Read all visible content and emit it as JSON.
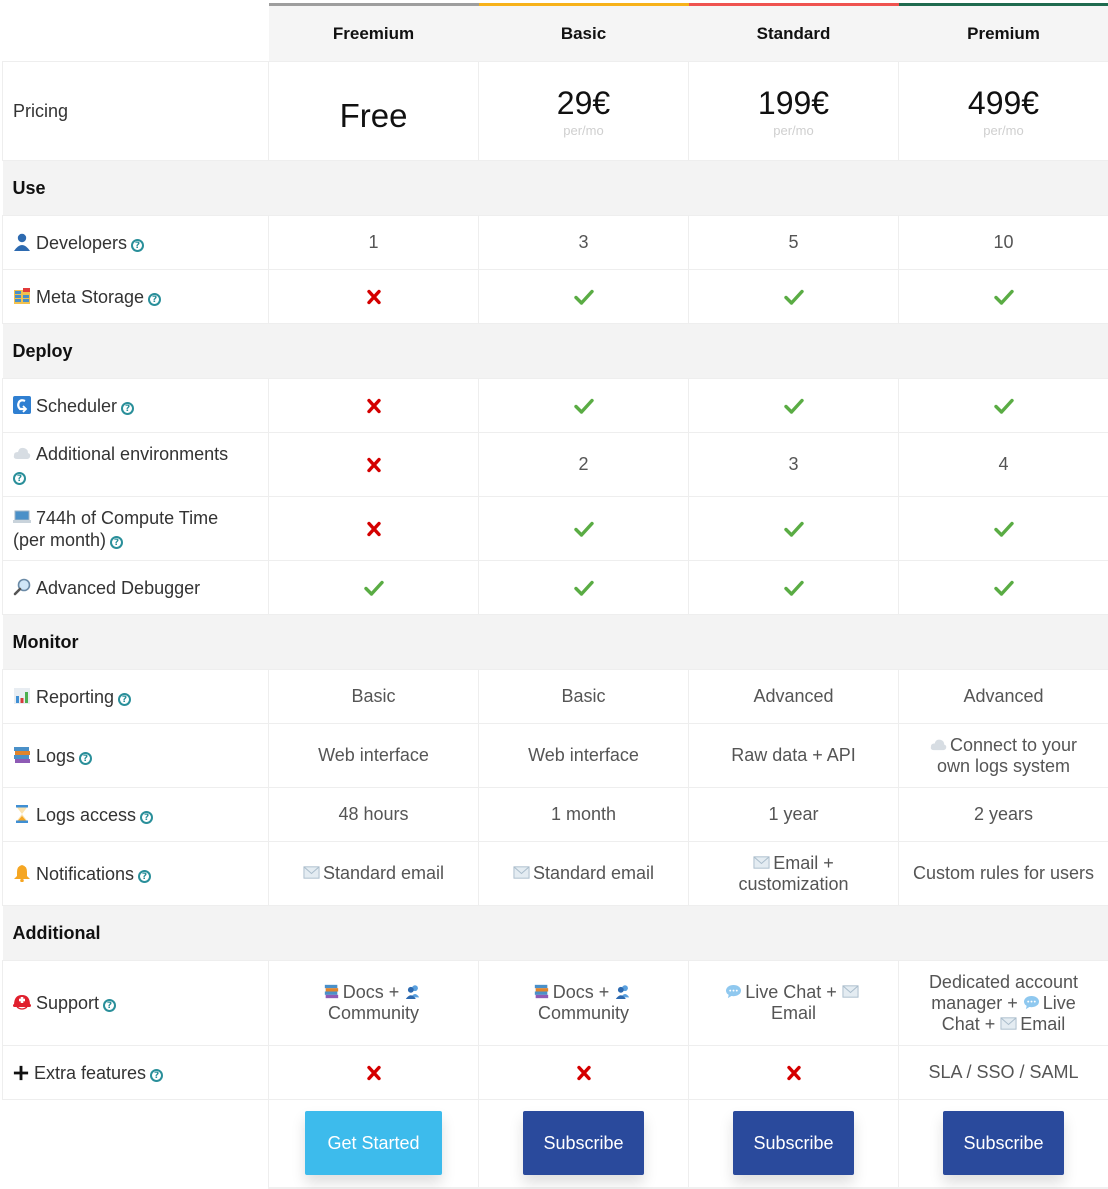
{
  "colors": {
    "freemium": "#9e9e9e",
    "basic": "#f7b21a",
    "standard": "#ef5350",
    "premium": "#1f6b4f",
    "check": "#5aac44",
    "cross": "#d40000",
    "help": "#2a8f9a",
    "get_started_bg": "#3dbbec",
    "subscribe_bg": "#2a4a9c"
  },
  "plans": [
    {
      "name": "Freemium",
      "price": "Free",
      "period": "",
      "cta": "Get Started"
    },
    {
      "name": "Basic",
      "price": "29€",
      "period": "per/mo",
      "cta": "Subscribe"
    },
    {
      "name": "Standard",
      "price": "199€",
      "period": "per/mo",
      "cta": "Subscribe"
    },
    {
      "name": "Premium",
      "price": "499€",
      "period": "per/mo",
      "cta": "Subscribe"
    }
  ],
  "pricing_label": "Pricing",
  "help_glyph": "?",
  "sections": {
    "use": {
      "title": "Use",
      "rows": [
        {
          "label": "Developers",
          "icon": "person-icon",
          "values": [
            "1",
            "3",
            "5",
            "10"
          ]
        },
        {
          "label": "Meta Storage",
          "icon": "storage-icon",
          "values": [
            "no",
            "yes",
            "yes",
            "yes"
          ]
        }
      ]
    },
    "deploy": {
      "title": "Deploy",
      "rows": [
        {
          "label": "Scheduler",
          "icon": "scheduler-icon",
          "values": [
            "no",
            "yes",
            "yes",
            "yes"
          ]
        },
        {
          "label": "Additional environments",
          "icon": "cloud-icon",
          "values": [
            "no",
            "2",
            "3",
            "4"
          ]
        },
        {
          "label": "744h of Compute Time (per month)",
          "label_line1": "744h of Compute Time",
          "label_line2": "(per month)",
          "icon": "laptop-icon",
          "values": [
            "no",
            "yes",
            "yes",
            "yes"
          ]
        },
        {
          "label": "Advanced Debugger",
          "icon": "magnifier-icon",
          "values": [
            "yes",
            "yes",
            "yes",
            "yes"
          ]
        }
      ]
    },
    "monitor": {
      "title": "Monitor",
      "rows": [
        {
          "label": "Reporting",
          "icon": "bar-chart-icon",
          "values": [
            "Basic",
            "Basic",
            "Advanced",
            "Advanced"
          ]
        },
        {
          "label": "Logs",
          "icon": "books-icon",
          "values": [
            "Web interface",
            "Web interface",
            "Raw data + API",
            "Connect to your own logs system"
          ]
        },
        {
          "label": "Logs access",
          "icon": "hourglass-icon",
          "values": [
            "48 hours",
            "1 month",
            "1 year",
            "2 years"
          ]
        },
        {
          "label": "Notifications",
          "icon": "bell-icon",
          "values": [
            "Standard email",
            "Standard email",
            "Email + customization",
            "Custom rules for users"
          ]
        }
      ]
    },
    "additional": {
      "title": "Additional",
      "rows": [
        {
          "label": "Support",
          "icon": "rescue-helmet-icon",
          "values": [
            "Docs + Community",
            "Docs + Community",
            "Live Chat + Email",
            "Dedicated account manager + Live Chat + Email"
          ]
        },
        {
          "label": "Extra features",
          "icon": "plus-icon",
          "values": [
            "no",
            "no",
            "no",
            "SLA / SSO / SAML"
          ]
        }
      ]
    }
  },
  "text_parts": {
    "docs": "Docs +",
    "community": "Community",
    "live_chat_plus": "Live Chat +",
    "email": "Email",
    "dedicated": "Dedicated account manager +",
    "live": "Live",
    "chat_plus": "Chat +",
    "email_plus": "Email +",
    "customization": "customization",
    "connect": "Connect to your own logs system"
  }
}
